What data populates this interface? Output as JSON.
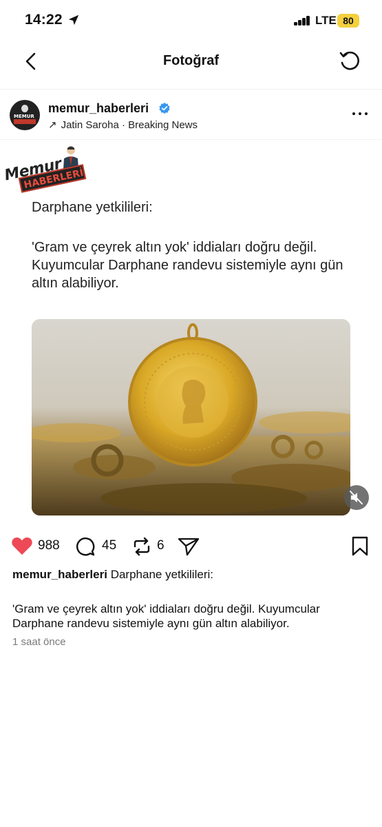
{
  "status_bar": {
    "time": "14:22",
    "network": "LTE",
    "battery": "80",
    "battery_color": "#f4d03f"
  },
  "nav": {
    "title": "Fotoğraf",
    "back_icon": "chevron-left-icon",
    "refresh_icon": "refresh-icon"
  },
  "post": {
    "username": "memur_haberleri",
    "verified_color": "#3897f0",
    "repost_by": "Jatin Saroha · Breaking News",
    "card": {
      "logo_top": "Memur",
      "logo_bottom": "HABERLERİ",
      "headline": "Darphane yetkilileri:",
      "body": "'Gram ve çeyrek altın yok' iddiaları doğru değil. Kuyumcular Darphane randevu sistemiyle aynı gün altın alabiliyor."
    },
    "image": {
      "description_icon": "gold-coin-photo"
    },
    "actions": {
      "likes": "988",
      "comments": "45",
      "reposts": "6",
      "like_color": "#ed4956"
    },
    "caption": {
      "username": "memur_haberleri",
      "lead": "Darphane yetkilileri:",
      "body": "'Gram ve çeyrek altın yok' iddiaları doğru değil. Kuyumcular Darphane randevu sistemiyle aynı gün altın alabiliyor."
    },
    "timestamp": "1 saat önce"
  }
}
